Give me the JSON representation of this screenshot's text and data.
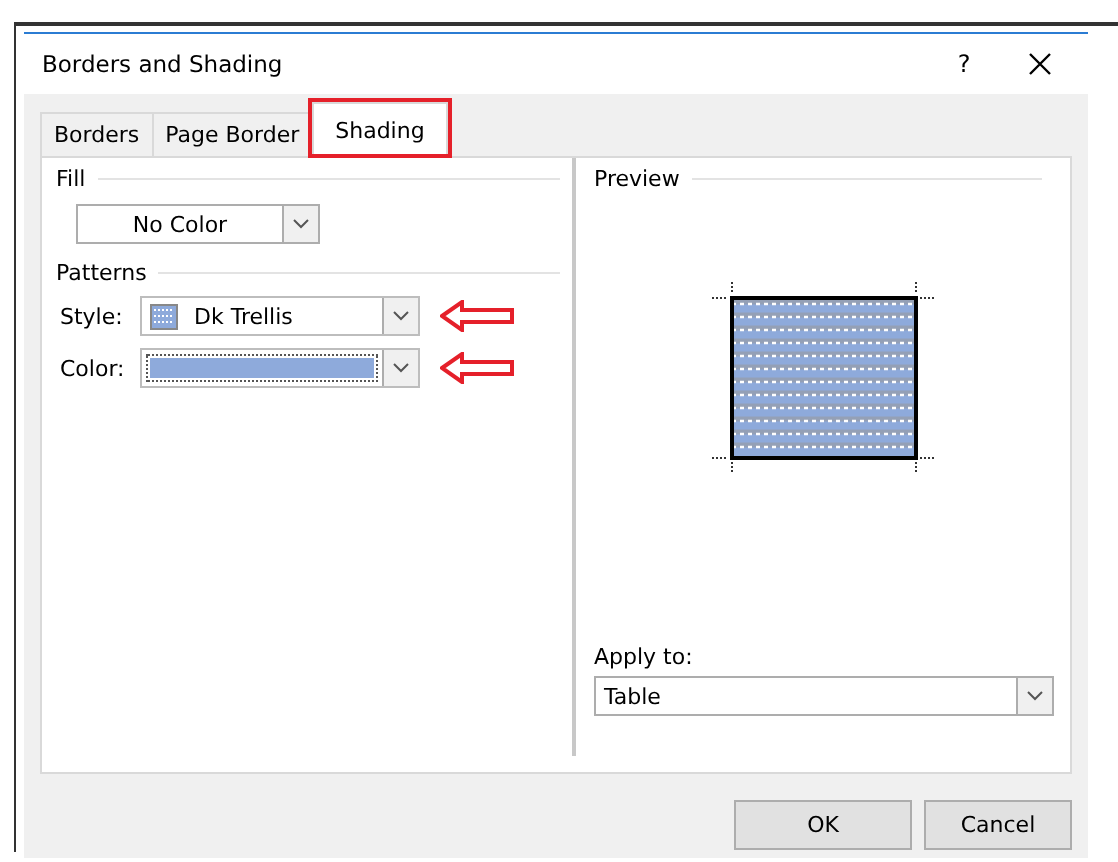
{
  "window": {
    "title": "Borders and Shading",
    "help": "?"
  },
  "tabs": [
    {
      "label": "Borders",
      "selected": false,
      "highlighted": false
    },
    {
      "label": "Page Border",
      "selected": false,
      "highlighted": false
    },
    {
      "label": "Shading",
      "selected": true,
      "highlighted": true
    }
  ],
  "fill": {
    "heading": "Fill",
    "value": "No Color"
  },
  "patterns": {
    "heading": "Patterns",
    "style": {
      "label": "Style:",
      "value": "Dk Trellis",
      "annotated": true
    },
    "color": {
      "label": "Color:",
      "color": "#8eaadb",
      "annotated": true
    }
  },
  "preview": {
    "heading": "Preview"
  },
  "apply_to": {
    "label": "Apply to:",
    "value": "Table"
  },
  "buttons": [
    "OK",
    "Cancel"
  ]
}
